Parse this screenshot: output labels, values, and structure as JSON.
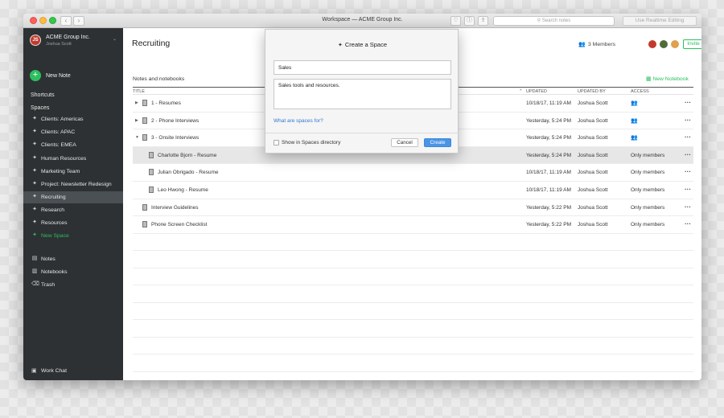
{
  "window": {
    "title": "Workspace — ACME Group Inc.",
    "search_placeholder": "Search notes",
    "realtime_label": "Use Realtime Editing"
  },
  "sidebar": {
    "org": "ACME Group Inc.",
    "user": "Joshua Scott",
    "avatar_initials": "JS",
    "new_note": "New Note",
    "shortcuts": "Shortcuts",
    "spaces": "Spaces",
    "space_items": [
      {
        "label": "Clients: Americas"
      },
      {
        "label": "Clients: APAC"
      },
      {
        "label": "Clients: EMEA"
      },
      {
        "label": "Human Resources"
      },
      {
        "label": "Marketing Team"
      },
      {
        "label": "Project: Newsletter Redesign"
      },
      {
        "label": "Recruiting"
      },
      {
        "label": "Research"
      },
      {
        "label": "Resources"
      },
      {
        "label": "New Space"
      }
    ],
    "bottom_items": [
      {
        "label": "Notes"
      },
      {
        "label": "Notebooks"
      },
      {
        "label": "Trash"
      }
    ],
    "work_chat": "Work Chat"
  },
  "main": {
    "title": "Recruiting",
    "members_label": "3 Members",
    "invite": "Invite",
    "notes_and_notebooks": "Notes and notebooks",
    "new_notebook": "New Notebook",
    "columns": {
      "title": "TITLE",
      "updated": "UPDATED",
      "updated_by": "UPDATED BY",
      "access": "ACCESS"
    },
    "rows": [
      {
        "title": "1 - Resumes",
        "updated": "10/18/17, 11:19 AM",
        "by": "Joshua Scott",
        "access": ""
      },
      {
        "title": "2 - Phone Interviews",
        "updated": "Yesterday, 5:24 PM",
        "by": "Joshua Scott",
        "access": ""
      },
      {
        "title": "3 - Onsite Interviews",
        "updated": "Yesterday, 5:24 PM",
        "by": "Joshua Scott",
        "access": ""
      },
      {
        "title": "Charlotte Bjorn - Resume",
        "updated": "Yesterday, 5:24 PM",
        "by": "Joshua Scott",
        "access": "Only members"
      },
      {
        "title": "Julian Obrigado - Resume",
        "updated": "10/18/17, 11:19 AM",
        "by": "Joshua Scott",
        "access": "Only members"
      },
      {
        "title": "Leo Hwong - Resume",
        "updated": "10/18/17, 11:19 AM",
        "by": "Joshua Scott",
        "access": "Only members"
      },
      {
        "title": "Interview Guidelines",
        "updated": "Yesterday, 5:22 PM",
        "by": "Joshua Scott",
        "access": "Only members"
      },
      {
        "title": "Phone Screen Checklist",
        "updated": "Yesterday, 5:22 PM",
        "by": "Joshua Scott",
        "access": "Only members"
      }
    ]
  },
  "dialog": {
    "title": "Create a Space",
    "name_value": "Sales",
    "description_value": "Sales tools and resources.",
    "help_link": "What are spaces for?",
    "checkbox_label": "Show in Spaces directory",
    "cancel": "Cancel",
    "create": "Create"
  },
  "colors": {
    "accent_green": "#2dbe60",
    "sidebar_bg": "#2d3133",
    "link_blue": "#2f77d0",
    "create_blue": "#4a94e6"
  }
}
